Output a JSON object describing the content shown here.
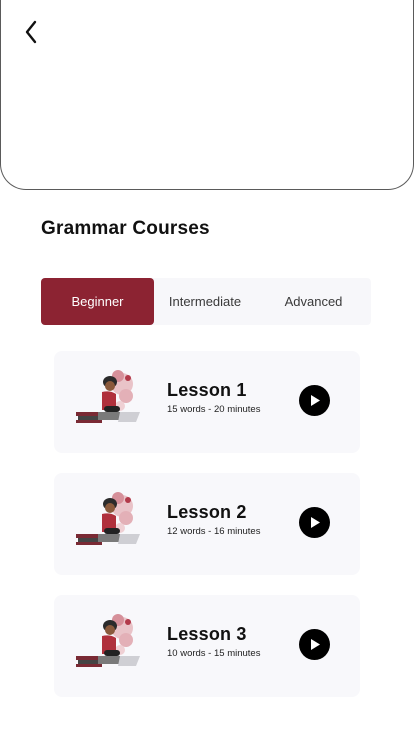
{
  "header": {
    "back_icon": "chevron-left-icon"
  },
  "section": {
    "title": "Grammar Courses"
  },
  "tabs": [
    {
      "label": "Beginner",
      "active": true
    },
    {
      "label": "Intermediate",
      "active": false
    },
    {
      "label": "Advanced",
      "active": false
    }
  ],
  "lessons": [
    {
      "title": "Lesson 1",
      "meta": "15 words - 20 minutes"
    },
    {
      "title": "Lesson 2",
      "meta": "12 words - 16 minutes"
    },
    {
      "title": "Lesson 3",
      "meta": "10 words - 15 minutes"
    }
  ],
  "colors": {
    "accent": "#8c2332",
    "card_bg": "#f8f8fb",
    "tab_bg": "#f7f7fa",
    "play": "#000000"
  }
}
